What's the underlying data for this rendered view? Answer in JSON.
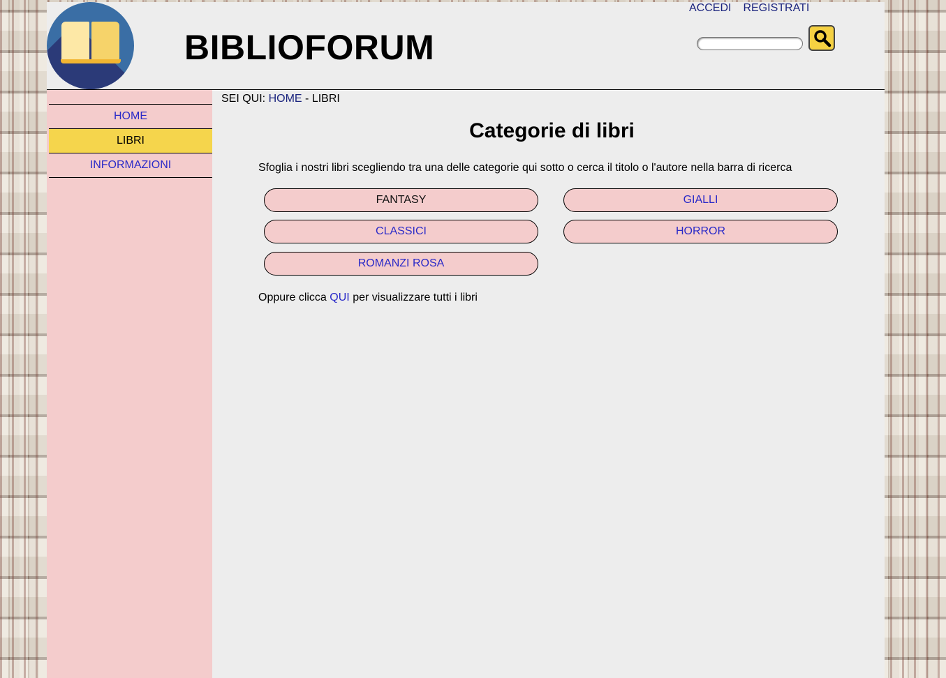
{
  "header": {
    "site_title": "BIBLIOFORUM",
    "links": {
      "login": "ACCEDI",
      "register": "REGISTRATI"
    },
    "search": {
      "value": "",
      "placeholder": ""
    }
  },
  "nav": {
    "items": [
      {
        "label": "HOME"
      },
      {
        "label": "LIBRI",
        "active": true
      },
      {
        "label": "INFORMAZIONI"
      }
    ]
  },
  "breadcrumb": {
    "prefix": "SEI QUI:",
    "home": "HOME",
    "separator": "-",
    "current": "LIBRI"
  },
  "main": {
    "title": "Categorie di libri",
    "intro": "Sfoglia i nostri libri scegliendo tra una delle categorie qui sotto o cerca il titolo o l'autore nella barra di ricerca",
    "categories": [
      {
        "label": "FANTASY"
      },
      {
        "label": "GIALLI"
      },
      {
        "label": "CLASSICI"
      },
      {
        "label": "HORROR"
      },
      {
        "label": "ROMANZI ROSA"
      }
    ],
    "all_prefix": "Oppure clicca",
    "all_link": "QUI",
    "all_suffix": "per visualizzare tutti i libri"
  },
  "colors": {
    "nav_bg": "#f4cccc",
    "active_bg": "#f5d54c",
    "link": "#2a2ac8",
    "page_bg": "#ededed",
    "logo_circle": "#3a6ea5"
  },
  "icons": {
    "logo": "open-book-icon",
    "search": "magnifier-icon"
  }
}
